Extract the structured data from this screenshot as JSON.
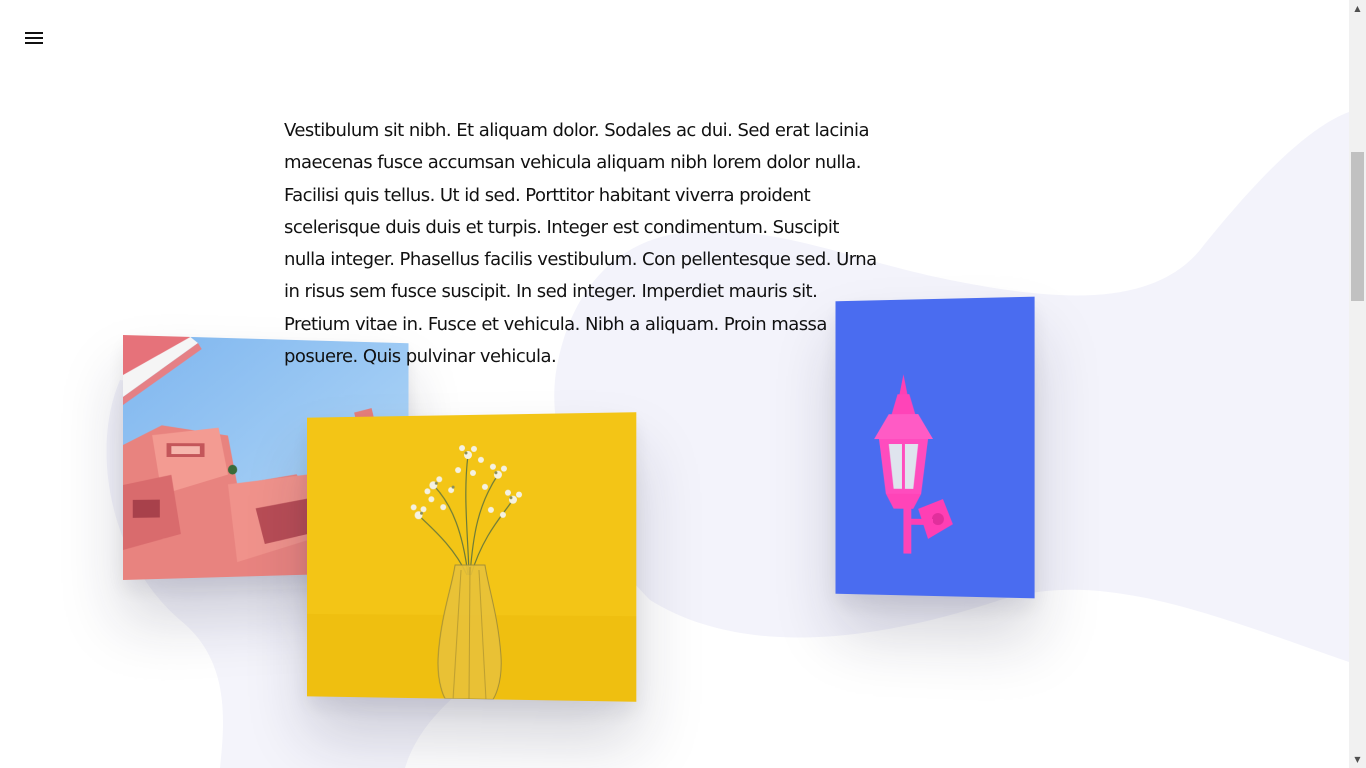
{
  "header": {
    "menu_icon": "hamburger-menu-icon"
  },
  "content": {
    "paragraph": "Vestibulum sit nibh. Et aliquam dolor. Sodales ac dui. Sed erat lacinia maecenas fusce accumsan vehicula aliquam nibh lorem dolor nulla. Facilisi quis tellus. Ut id sed. Porttitor habitant viverra proident scelerisque duis duis et turpis. Integer est condimentum. Suscipit nulla integer. Phasellus facilis vestibulum. Con pellentesque sed. Urna in risus sem fusce suscipit. In sed integer. Imperdiet mauris sit. Pretium vitae in. Fusce et vehicula. Nibh a aliquam. Proin massa posuere. Quis pulvinar vehicula."
  },
  "gallery": {
    "images": [
      {
        "subject": "pink-building",
        "background": "#8ec3f2"
      },
      {
        "subject": "flowers-in-vase",
        "background": "#f2c418"
      },
      {
        "subject": "pink-wall-lamp",
        "background": "#4a6cf0"
      }
    ]
  },
  "colors": {
    "text": "#111111",
    "blob": "#f3f3fb",
    "background": "#ffffff"
  },
  "scrollbar": {
    "up_arrow": "▲",
    "down_arrow": "▼"
  }
}
